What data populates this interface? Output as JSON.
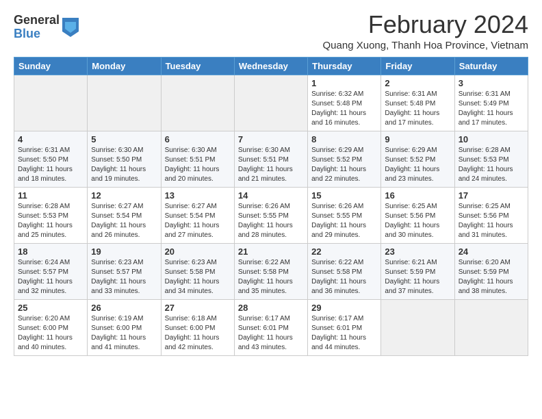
{
  "logo": {
    "general": "General",
    "blue": "Blue"
  },
  "header": {
    "month": "February 2024",
    "location": "Quang Xuong, Thanh Hoa Province, Vietnam"
  },
  "weekdays": [
    "Sunday",
    "Monday",
    "Tuesday",
    "Wednesday",
    "Thursday",
    "Friday",
    "Saturday"
  ],
  "weeks": [
    [
      {
        "day": "",
        "info": ""
      },
      {
        "day": "",
        "info": ""
      },
      {
        "day": "",
        "info": ""
      },
      {
        "day": "",
        "info": ""
      },
      {
        "day": "1",
        "info": "Sunrise: 6:32 AM\nSunset: 5:48 PM\nDaylight: 11 hours and 16 minutes."
      },
      {
        "day": "2",
        "info": "Sunrise: 6:31 AM\nSunset: 5:48 PM\nDaylight: 11 hours and 17 minutes."
      },
      {
        "day": "3",
        "info": "Sunrise: 6:31 AM\nSunset: 5:49 PM\nDaylight: 11 hours and 17 minutes."
      }
    ],
    [
      {
        "day": "4",
        "info": "Sunrise: 6:31 AM\nSunset: 5:50 PM\nDaylight: 11 hours and 18 minutes."
      },
      {
        "day": "5",
        "info": "Sunrise: 6:30 AM\nSunset: 5:50 PM\nDaylight: 11 hours and 19 minutes."
      },
      {
        "day": "6",
        "info": "Sunrise: 6:30 AM\nSunset: 5:51 PM\nDaylight: 11 hours and 20 minutes."
      },
      {
        "day": "7",
        "info": "Sunrise: 6:30 AM\nSunset: 5:51 PM\nDaylight: 11 hours and 21 minutes."
      },
      {
        "day": "8",
        "info": "Sunrise: 6:29 AM\nSunset: 5:52 PM\nDaylight: 11 hours and 22 minutes."
      },
      {
        "day": "9",
        "info": "Sunrise: 6:29 AM\nSunset: 5:52 PM\nDaylight: 11 hours and 23 minutes."
      },
      {
        "day": "10",
        "info": "Sunrise: 6:28 AM\nSunset: 5:53 PM\nDaylight: 11 hours and 24 minutes."
      }
    ],
    [
      {
        "day": "11",
        "info": "Sunrise: 6:28 AM\nSunset: 5:53 PM\nDaylight: 11 hours and 25 minutes."
      },
      {
        "day": "12",
        "info": "Sunrise: 6:27 AM\nSunset: 5:54 PM\nDaylight: 11 hours and 26 minutes."
      },
      {
        "day": "13",
        "info": "Sunrise: 6:27 AM\nSunset: 5:54 PM\nDaylight: 11 hours and 27 minutes."
      },
      {
        "day": "14",
        "info": "Sunrise: 6:26 AM\nSunset: 5:55 PM\nDaylight: 11 hours and 28 minutes."
      },
      {
        "day": "15",
        "info": "Sunrise: 6:26 AM\nSunset: 5:55 PM\nDaylight: 11 hours and 29 minutes."
      },
      {
        "day": "16",
        "info": "Sunrise: 6:25 AM\nSunset: 5:56 PM\nDaylight: 11 hours and 30 minutes."
      },
      {
        "day": "17",
        "info": "Sunrise: 6:25 AM\nSunset: 5:56 PM\nDaylight: 11 hours and 31 minutes."
      }
    ],
    [
      {
        "day": "18",
        "info": "Sunrise: 6:24 AM\nSunset: 5:57 PM\nDaylight: 11 hours and 32 minutes."
      },
      {
        "day": "19",
        "info": "Sunrise: 6:23 AM\nSunset: 5:57 PM\nDaylight: 11 hours and 33 minutes."
      },
      {
        "day": "20",
        "info": "Sunrise: 6:23 AM\nSunset: 5:58 PM\nDaylight: 11 hours and 34 minutes."
      },
      {
        "day": "21",
        "info": "Sunrise: 6:22 AM\nSunset: 5:58 PM\nDaylight: 11 hours and 35 minutes."
      },
      {
        "day": "22",
        "info": "Sunrise: 6:22 AM\nSunset: 5:58 PM\nDaylight: 11 hours and 36 minutes."
      },
      {
        "day": "23",
        "info": "Sunrise: 6:21 AM\nSunset: 5:59 PM\nDaylight: 11 hours and 37 minutes."
      },
      {
        "day": "24",
        "info": "Sunrise: 6:20 AM\nSunset: 5:59 PM\nDaylight: 11 hours and 38 minutes."
      }
    ],
    [
      {
        "day": "25",
        "info": "Sunrise: 6:20 AM\nSunset: 6:00 PM\nDaylight: 11 hours and 40 minutes."
      },
      {
        "day": "26",
        "info": "Sunrise: 6:19 AM\nSunset: 6:00 PM\nDaylight: 11 hours and 41 minutes."
      },
      {
        "day": "27",
        "info": "Sunrise: 6:18 AM\nSunset: 6:00 PM\nDaylight: 11 hours and 42 minutes."
      },
      {
        "day": "28",
        "info": "Sunrise: 6:17 AM\nSunset: 6:01 PM\nDaylight: 11 hours and 43 minutes."
      },
      {
        "day": "29",
        "info": "Sunrise: 6:17 AM\nSunset: 6:01 PM\nDaylight: 11 hours and 44 minutes."
      },
      {
        "day": "",
        "info": ""
      },
      {
        "day": "",
        "info": ""
      }
    ]
  ]
}
